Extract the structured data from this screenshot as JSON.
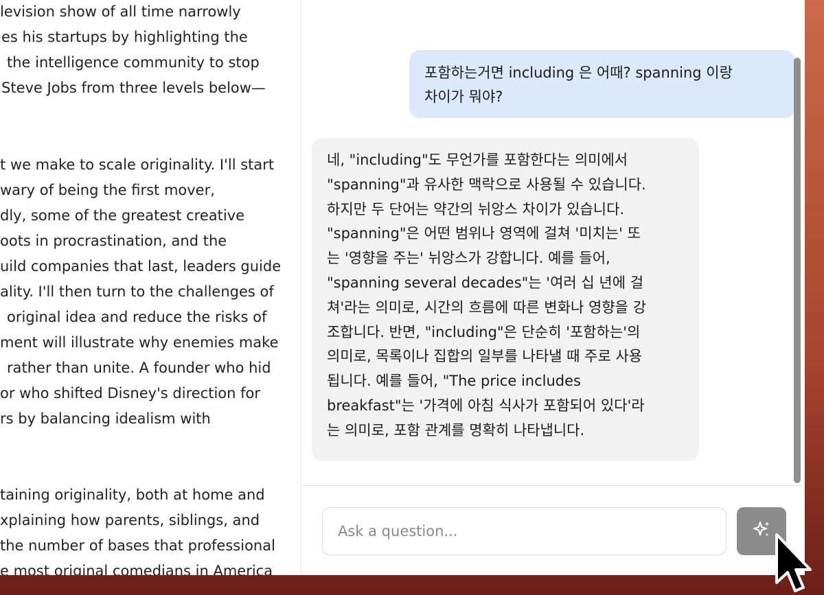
{
  "document": {
    "paragraphs": [
      {
        "lines": [
          "levision show of all time narrowly",
          "es his startups by highlighting the",
          "the intelligence community to stop",
          "Steve Jobs from three levels below—"
        ]
      },
      {
        "lines": [
          "t we make to scale originality. I'll start",
          "wary of being the first mover,",
          "dly, some of the greatest creative",
          "oots in procrastination, and the",
          "uild companies that last, leaders guide",
          "ality. I'll then turn to the challenges of",
          "original idea and reduce the risks of",
          "ment will illustrate why enemies make",
          "rather than unite. A founder who hid",
          "or who shifted Disney's direction for",
          "rs by balancing idealism with"
        ]
      },
      {
        "lines": [
          "taining originality, both at home and",
          "xplaining how parents, siblings, and",
          "the number of bases that professional",
          "e most original comedians in America"
        ]
      }
    ]
  },
  "chat": {
    "user_message": {
      "lines": [
        "포함하는거면 including 은 어때? spanning 이랑",
        "차이가 뭐야?"
      ]
    },
    "assistant_message": {
      "lines": [
        "네, \"including\"도 무언가를 포함한다는 의미에서",
        "\"spanning\"과 유사한 맥락으로 사용될 수 있습니다.",
        "하지만 두 단어는 약간의 뉘앙스 차이가 있습니다.",
        "\"spanning\"은 어떤 범위나 영역에 걸쳐 '미치는' 또",
        "는 '영향을 주는' 뉘앙스가 강합니다. 예를 들어,",
        "\"spanning several decades\"는 '여러 십 년에 걸",
        "쳐'라는 의미로, 시간의 흐름에 따른 변화나 영향을 강",
        "조합니다. 반면, \"including\"은 단순히 '포함하는'의",
        "의미로, 목록이나 집합의 일부를 나타낼 때 주로 사용",
        "됩니다. 예를 들어, \"The price includes",
        "breakfast\"는 '가격에 아침 식사가 포함되어 있다'라",
        "는 의미로, 포함 관계를 명확히 나타냅니다."
      ]
    },
    "composer": {
      "placeholder": "Ask a question...",
      "send_icon": "sparkle-icon"
    }
  },
  "colors": {
    "user_bubble": "#dbe9fb",
    "assistant_bubble": "#f2f2f2",
    "send_button": "#8c8c8c",
    "desktop": "#a8452f"
  }
}
